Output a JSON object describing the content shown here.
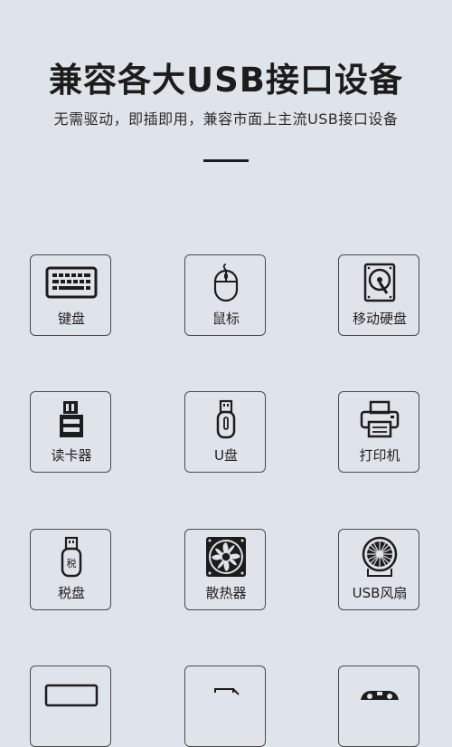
{
  "header": {
    "title": "兼容各大USB接口设备",
    "subtitle": "无需驱动，即插即用，兼容市面上主流USB接口设备"
  },
  "devices": [
    {
      "label": "键盘",
      "icon": "keyboard-icon"
    },
    {
      "label": "鼠标",
      "icon": "mouse-icon"
    },
    {
      "label": "移动硬盘",
      "icon": "hard-drive-icon"
    },
    {
      "label": "读卡器",
      "icon": "card-reader-icon"
    },
    {
      "label": "U盘",
      "icon": "usb-flash-drive-icon"
    },
    {
      "label": "打印机",
      "icon": "printer-icon"
    },
    {
      "label": "税盘",
      "icon": "tax-disk-icon",
      "icon_text": "税"
    },
    {
      "label": "散热器",
      "icon": "cooling-fan-icon"
    },
    {
      "label": "USB风扇",
      "icon": "usb-fan-icon"
    }
  ],
  "colors": {
    "background": "#dfe4ea",
    "text": "#1c1c1c",
    "border": "#4a4a4a"
  }
}
